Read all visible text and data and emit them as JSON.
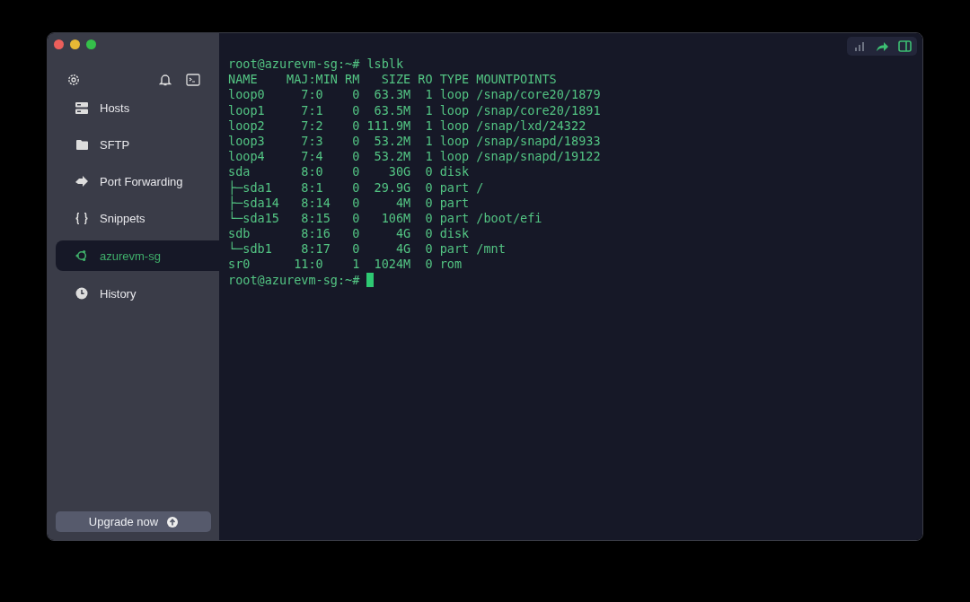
{
  "sidebar": {
    "items": [
      {
        "kind": "hosts",
        "label": "Hosts",
        "selected": false
      },
      {
        "kind": "sftp",
        "label": "SFTP",
        "selected": false
      },
      {
        "kind": "forwarding",
        "label": "Port Forwarding",
        "selected": false
      },
      {
        "kind": "snippets",
        "label": "Snippets",
        "selected": false
      },
      {
        "kind": "host",
        "label": "azurevm-sg",
        "selected": true
      },
      {
        "kind": "history",
        "label": "History",
        "selected": false
      }
    ],
    "upgrade_button": "Upgrade now"
  },
  "terminal": {
    "lines": [
      "root@azurevm-sg:~# lsblk",
      "NAME    MAJ:MIN RM   SIZE RO TYPE MOUNTPOINTS",
      "loop0     7:0    0  63.3M  1 loop /snap/core20/1879",
      "loop1     7:1    0  63.5M  1 loop /snap/core20/1891",
      "loop2     7:2    0 111.9M  1 loop /snap/lxd/24322",
      "loop3     7:3    0  53.2M  1 loop /snap/snapd/18933",
      "loop4     7:4    0  53.2M  1 loop /snap/snapd/19122",
      "sda       8:0    0    30G  0 disk",
      "├─sda1    8:1    0  29.9G  0 part /",
      "├─sda14   8:14   0     4M  0 part",
      "└─sda15   8:15   0   106M  0 part /boot/efi",
      "sdb       8:16   0     4G  0 disk",
      "└─sdb1    8:17   0     4G  0 part /mnt",
      "sr0      11:0    1  1024M  0 rom"
    ],
    "prompt": "root@azurevm-sg:~#"
  }
}
